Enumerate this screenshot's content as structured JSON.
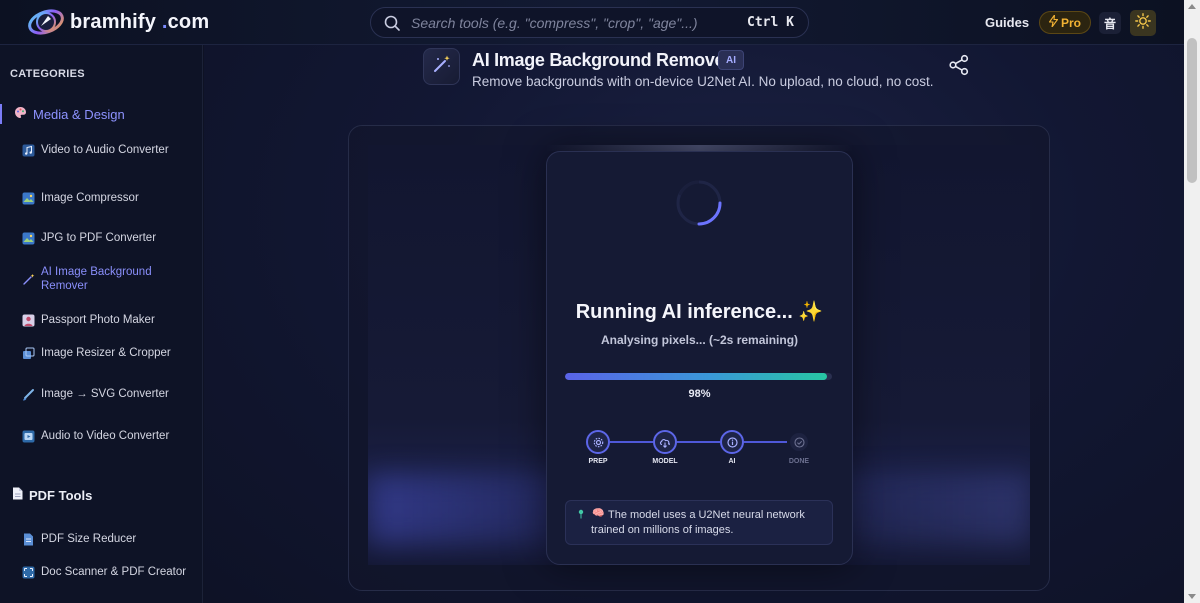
{
  "header": {
    "logo_text": "bramhify",
    "logo_dot": ".",
    "logo_tld": "com",
    "search_placeholder": "Search tools (e.g. \"compress\", \"crop\", \"age\"...)",
    "search_shortcut": "Ctrl K",
    "nav_guides": "Guides",
    "pro_label": "Pro",
    "lang_label": "音",
    "icons": {
      "search": "search-icon",
      "pro": "lightning-icon",
      "theme": "sun-icon"
    }
  },
  "sidebar": {
    "title": "CATEGORIES",
    "sections": [
      {
        "label": "Media & Design",
        "icon": "palette-icon",
        "active": true,
        "items": [
          {
            "label": "Video to Audio Converter",
            "icon": "music-icon"
          },
          {
            "label": "Image Compressor",
            "icon": "image-icon"
          },
          {
            "label": "JPG to PDF Converter",
            "icon": "image-icon"
          },
          {
            "label": "AI Image Background Remover",
            "icon": "magic-wand-icon",
            "active": true
          },
          {
            "label": "Passport Photo Maker",
            "icon": "portrait-icon"
          },
          {
            "label": "Image Resizer & Cropper",
            "icon": "resize-icon"
          },
          {
            "label": "Image → SVG Converter",
            "icon": "brush-icon"
          },
          {
            "label": "Audio to Video Converter",
            "icon": "video-icon"
          }
        ]
      },
      {
        "label": "PDF Tools",
        "icon": "document-icon",
        "items": [
          {
            "label": "PDF Size Reducer",
            "icon": "document-icon"
          },
          {
            "label": "Doc Scanner & PDF Creator",
            "icon": "scanner-icon"
          }
        ]
      }
    ]
  },
  "tool": {
    "title": "AI Image Background Remover",
    "badge": "AI",
    "subtitle": "Remove backgrounds with on-device U2Net AI. No upload, no cloud, no cost.",
    "icon": "magic-wand-icon",
    "share_icon": "share-icon"
  },
  "progress": {
    "title": "Running AI inference... ✨",
    "status": "Analysing pixels... (~2s remaining)",
    "percent_value": 98,
    "percent_label": "98%",
    "colors": {
      "bar_start": "#5a63e8",
      "bar_end": "#27c7a3",
      "accent": "#5c66e8"
    },
    "steps": [
      {
        "label": "PREP",
        "state": "done",
        "icon": "gear-icon"
      },
      {
        "label": "MODEL",
        "state": "done",
        "icon": "cloud-download-icon"
      },
      {
        "label": "AI",
        "state": "active",
        "icon": "info-icon"
      },
      {
        "label": "DONE",
        "state": "pending",
        "icon": "check-icon"
      }
    ],
    "tip": {
      "pin_icon": "pin-icon",
      "emoji": "🧠",
      "text": "The model uses a U2Net neural network trained on millions of images."
    }
  }
}
